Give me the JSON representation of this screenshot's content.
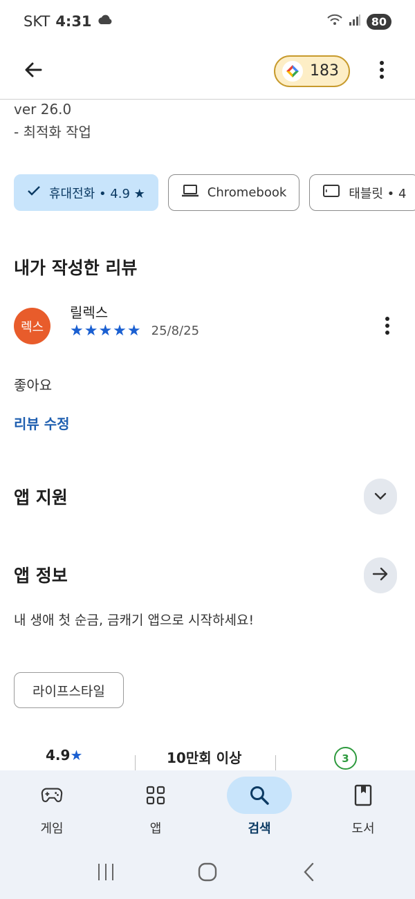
{
  "status_bar": {
    "carrier": "SKT",
    "time": "4:31",
    "battery": "80"
  },
  "header": {
    "points": "183"
  },
  "whats_new": {
    "version": "ver 26.0",
    "note": "- 최적화 작업"
  },
  "device_chips": [
    {
      "label": "휴대전화 • 4.9 ★",
      "icon": "check-icon",
      "selected": true
    },
    {
      "label": "Chromebook",
      "icon": "laptop-icon",
      "selected": false
    },
    {
      "label": "태블릿 • 4",
      "icon": "tablet-icon",
      "selected": false
    }
  ],
  "my_review": {
    "section_title": "내가 작성한 리뷰",
    "avatar_text": "렉스",
    "reviewer_name": "릴렉스",
    "rating": 5,
    "stars": "★★★★★",
    "date": "25/8/25",
    "text": "좋아요",
    "edit_label": "리뷰 수정"
  },
  "app_support": {
    "title": "앱 지원"
  },
  "app_info": {
    "title": "앱 정보",
    "description": "내 생애 첫 순금, 금캐기 앱으로 시작하세요!",
    "category": "라이프스타일"
  },
  "stats": {
    "rating": "4.9",
    "rating_star": "★",
    "downloads": "10만회 이상",
    "age_rating": "3"
  },
  "bottom_nav": [
    {
      "label": "게임",
      "icon": "gamepad-icon",
      "active": false
    },
    {
      "label": "앱",
      "icon": "apps-grid-icon",
      "active": false
    },
    {
      "label": "검색",
      "icon": "search-icon",
      "active": true
    },
    {
      "label": "도서",
      "icon": "book-icon",
      "active": false
    }
  ],
  "colors": {
    "accent": "#1a5fd1",
    "chip_selected": "#c8e4fb",
    "avatar": "#e85c2b",
    "nav_bg": "#eef2f8"
  }
}
